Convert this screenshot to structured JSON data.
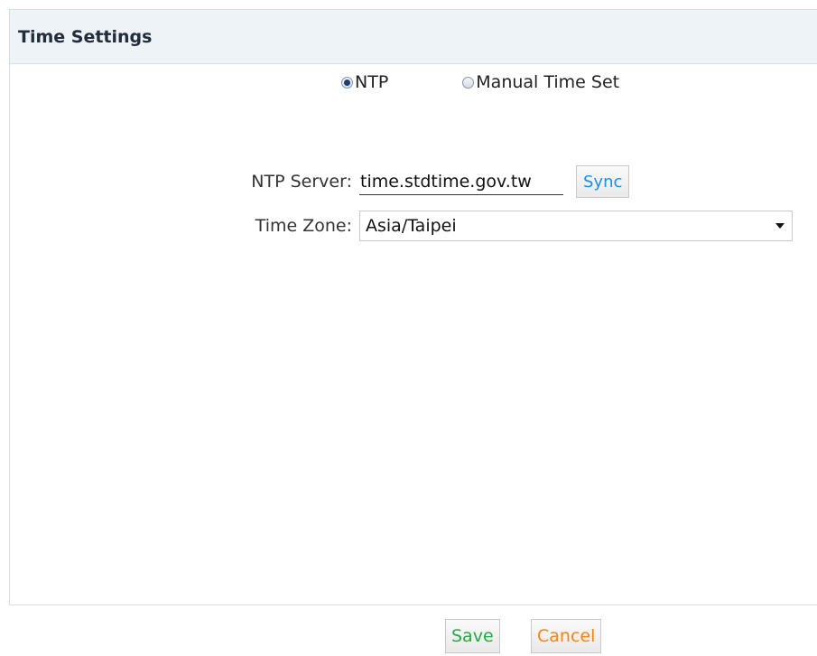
{
  "header": {
    "title": "Time Settings"
  },
  "mode": {
    "options": [
      {
        "label": "NTP",
        "checked": true
      },
      {
        "label": "Manual Time Set",
        "checked": false
      }
    ]
  },
  "ntp_server": {
    "label": "NTP Server:",
    "value": "time.stdtime.gov.tw",
    "sync_label": "Sync"
  },
  "time_zone": {
    "label": "Time Zone:",
    "value": "Asia/Taipei"
  },
  "footer": {
    "save_label": "Save",
    "cancel_label": "Cancel"
  },
  "colors": {
    "header_bg": "#eef3f8",
    "sync_text": "#1a8fe3",
    "save_text": "#28a745",
    "cancel_text": "#f08519"
  }
}
